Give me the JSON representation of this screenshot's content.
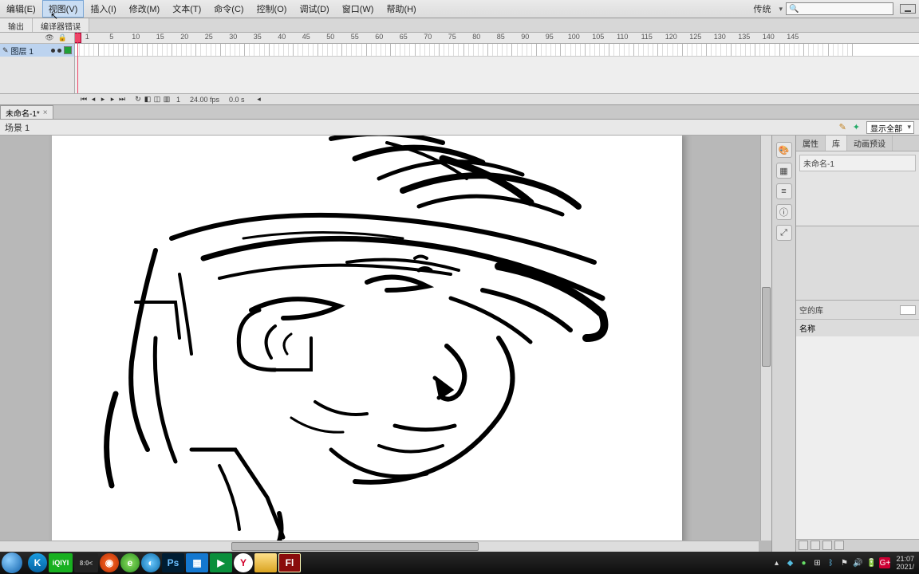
{
  "menu": {
    "items": [
      "编辑(E)",
      "视图(V)",
      "插入(I)",
      "修改(M)",
      "文本(T)",
      "命令(C)",
      "控制(O)",
      "调试(D)",
      "窗口(W)",
      "帮助(H)"
    ],
    "active_index": 1,
    "workspace_label": "传统",
    "search_placeholder": ""
  },
  "subtabs": [
    "输出",
    "编译器错误"
  ],
  "timeline": {
    "layer_name": "图层 1",
    "ruler_marks": [
      "1",
      "5",
      "10",
      "15",
      "20",
      "25",
      "30",
      "35",
      "40",
      "45",
      "50",
      "55",
      "60",
      "65",
      "70",
      "75",
      "80",
      "85",
      "90",
      "95",
      "100",
      "105",
      "110",
      "115",
      "120",
      "125",
      "130",
      "135",
      "140",
      "145"
    ],
    "current_frame": "1",
    "fps": "24.00 fps",
    "elapsed": "0.0 s"
  },
  "document": {
    "tab_title": "未命名-1*"
  },
  "scene": {
    "name": "场景 1",
    "zoom_label": "显示全部"
  },
  "right_panels": {
    "tabs": [
      "属性",
      "库",
      "动画预设"
    ],
    "active_tab": 1,
    "library_doc": "未命名-1",
    "empty_label": "空的库",
    "name_header": "名称"
  },
  "taskbar": {
    "apps": [
      {
        "id": "k",
        "label": "K"
      },
      {
        "id": "iqiyi",
        "label": "iQIYI"
      },
      {
        "id": "oc",
        "label": "8:0<"
      },
      {
        "id": "red",
        "label": "◉"
      },
      {
        "id": "green",
        "label": "e"
      },
      {
        "id": "bluec",
        "label": "◐"
      },
      {
        "id": "ps",
        "label": "Ps"
      },
      {
        "id": "tiles",
        "label": "▦"
      },
      {
        "id": "play",
        "label": "▶"
      },
      {
        "id": "y",
        "label": "Y"
      },
      {
        "id": "folder",
        "label": ""
      },
      {
        "id": "fl",
        "label": "Fl"
      }
    ],
    "time": "21:07",
    "date": "2021/"
  }
}
